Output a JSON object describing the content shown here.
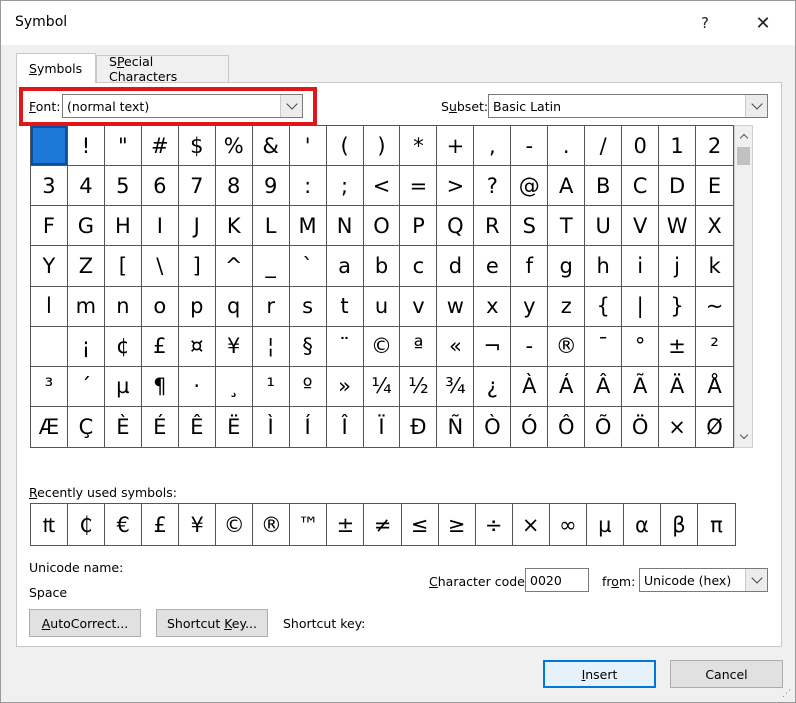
{
  "dialog": {
    "title": "Symbol",
    "help_label": "?",
    "close_label": "✕"
  },
  "tabs": [
    {
      "label": "Symbols",
      "mnemonic": "S",
      "rest": "ymbols",
      "active": true
    },
    {
      "label": "Special Characters",
      "mnemonic": "P",
      "pre": "S",
      "rest": "ecial Characters",
      "active": false
    }
  ],
  "font": {
    "mnemonic": "F",
    "label_rest": "ont:",
    "value": "(normal text)"
  },
  "subset": {
    "pre": "S",
    "mnemonic": "u",
    "label_rest": "bset:",
    "value": "Basic Latin"
  },
  "symbol_grid": {
    "selected_index": 0,
    "rows": [
      [
        " ",
        "!",
        "\"",
        "#",
        "$",
        "%",
        "&",
        "'",
        "(",
        ")",
        "*",
        "+",
        ",",
        "-",
        ".",
        "/",
        "0",
        "1",
        "2"
      ],
      [
        "3",
        "4",
        "5",
        "6",
        "7",
        "8",
        "9",
        ":",
        ";",
        "<",
        "=",
        ">",
        "?",
        "@",
        "A",
        "B",
        "C",
        "D",
        "E"
      ],
      [
        "F",
        "G",
        "H",
        "I",
        "J",
        "K",
        "L",
        "M",
        "N",
        "O",
        "P",
        "Q",
        "R",
        "S",
        "T",
        "U",
        "V",
        "W",
        "X"
      ],
      [
        "Y",
        "Z",
        "[",
        "\\",
        "]",
        "^",
        "_",
        "`",
        "a",
        "b",
        "c",
        "d",
        "e",
        "f",
        "g",
        "h",
        "i",
        "j",
        "k"
      ],
      [
        "l",
        "m",
        "n",
        "o",
        "p",
        "q",
        "r",
        "s",
        "t",
        "u",
        "v",
        "w",
        "x",
        "y",
        "z",
        "{",
        "|",
        "}",
        "~"
      ],
      [
        " ",
        "¡",
        "¢",
        "£",
        "¤",
        "¥",
        "¦",
        "§",
        "¨",
        "©",
        "ª",
        "«",
        "¬",
        "-",
        "®",
        "¯",
        "°",
        "±",
        "²"
      ],
      [
        "³",
        "´",
        "µ",
        "¶",
        "·",
        "¸",
        "¹",
        "º",
        "»",
        "¼",
        "½",
        "¾",
        "¿",
        "À",
        "Á",
        "Â",
        "Ã",
        "Ä",
        "Å"
      ],
      [
        "Æ",
        "Ç",
        "È",
        "É",
        "Ê",
        "Ë",
        "Ì",
        "Í",
        "Î",
        "Ï",
        "Ð",
        "Ñ",
        "Ò",
        "Ó",
        "Ô",
        "Õ",
        "Ö",
        "×",
        "Ø"
      ]
    ]
  },
  "recent": {
    "label_pre": "",
    "mnemonic": "R",
    "label_rest": "ecently used symbols:",
    "symbols": [
      "₶",
      "₵",
      "€",
      "£",
      "¥",
      "©",
      "®",
      "™",
      "±",
      "≠",
      "≤",
      "≥",
      "÷",
      "×",
      "∞",
      "µ",
      "α",
      "β",
      "π"
    ]
  },
  "unicode_name": {
    "label": "Unicode name:",
    "value": "Space"
  },
  "char_code": {
    "mnemonic": "C",
    "label_rest": "haracter code:",
    "value": "0020"
  },
  "from": {
    "pre": "fr",
    "mnemonic": "o",
    "label_rest": "m:",
    "value": "Unicode (hex)"
  },
  "buttons": {
    "autocorrect": {
      "mnemonic": "A",
      "rest": "utoCorrect..."
    },
    "shortcut_key": {
      "pre": "Shortcut ",
      "mnemonic": "K",
      "rest": "ey..."
    },
    "insert": {
      "mnemonic": "I",
      "rest": "nsert"
    },
    "cancel": "Cancel"
  },
  "shortcut_key_label": "Shortcut key:",
  "colors": {
    "selection": "#1e78d7",
    "highlight_box": "#e0161b",
    "default_button_border": "#0078d7"
  }
}
